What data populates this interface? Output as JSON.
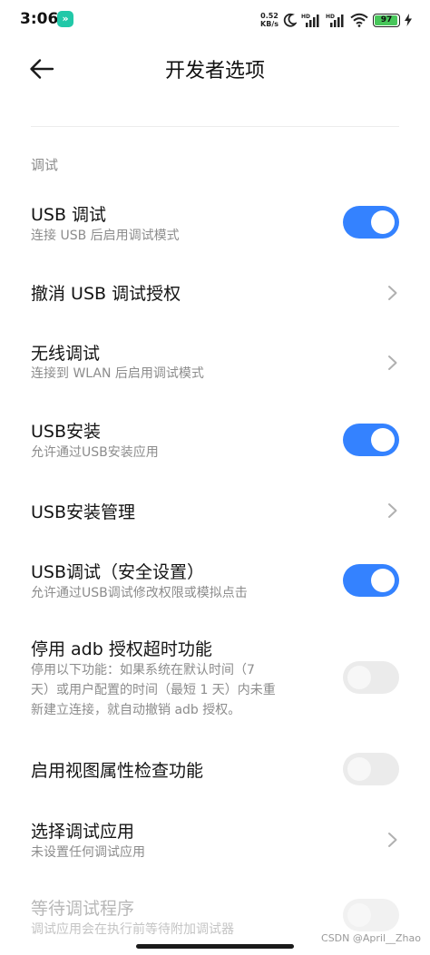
{
  "status_bar": {
    "time": "3:06",
    "app_badge": "»",
    "net_speed_value": "0.52",
    "net_speed_unit": "KB/s",
    "battery": "97",
    "battery_level": 0.97
  },
  "header": {
    "title": "开发者选项"
  },
  "section": {
    "title": "调试"
  },
  "rows": [
    {
      "title": "USB 调试",
      "subtitle": "连接 USB 后启用调试模式",
      "control": "toggle",
      "on": true
    },
    {
      "title": "撤消 USB 调试授权",
      "control": "chevron"
    },
    {
      "title": "无线调试",
      "subtitle": "连接到 WLAN 后启用调试模式",
      "control": "chevron"
    },
    {
      "title": "USB安装",
      "subtitle": "允许通过USB安装应用",
      "control": "toggle",
      "on": true
    },
    {
      "title": "USB安装管理",
      "control": "chevron"
    },
    {
      "title": "USB调试（安全设置）",
      "subtitle": "允许通过USB调试修改权限或模拟点击",
      "control": "toggle",
      "on": true
    },
    {
      "title": "停用 adb 授权超时功能",
      "subtitle_lines": [
        "停用以下功能：如果系统在默认时间（7",
        "天）或用户配置的时间（最短 1 天）内未重",
        "新建立连接，就自动撤销 adb 授权。"
      ],
      "control": "toggle",
      "on": false
    },
    {
      "title": "启用视图属性检查功能",
      "control": "toggle",
      "on": false
    },
    {
      "title": "选择调试应用",
      "subtitle": "未设置任何调试应用",
      "control": "chevron"
    },
    {
      "title": "等待调试程序",
      "subtitle": "调试应用会在执行前等待附加调试器",
      "control": "toggle",
      "on": false,
      "disabled": true
    }
  ],
  "watermark": "CSDN @April__Zhao",
  "colors": {
    "toggle_on": "#3482ff",
    "toggle_off": "#ebebeb",
    "secondary_text": "#8c8c8c"
  }
}
